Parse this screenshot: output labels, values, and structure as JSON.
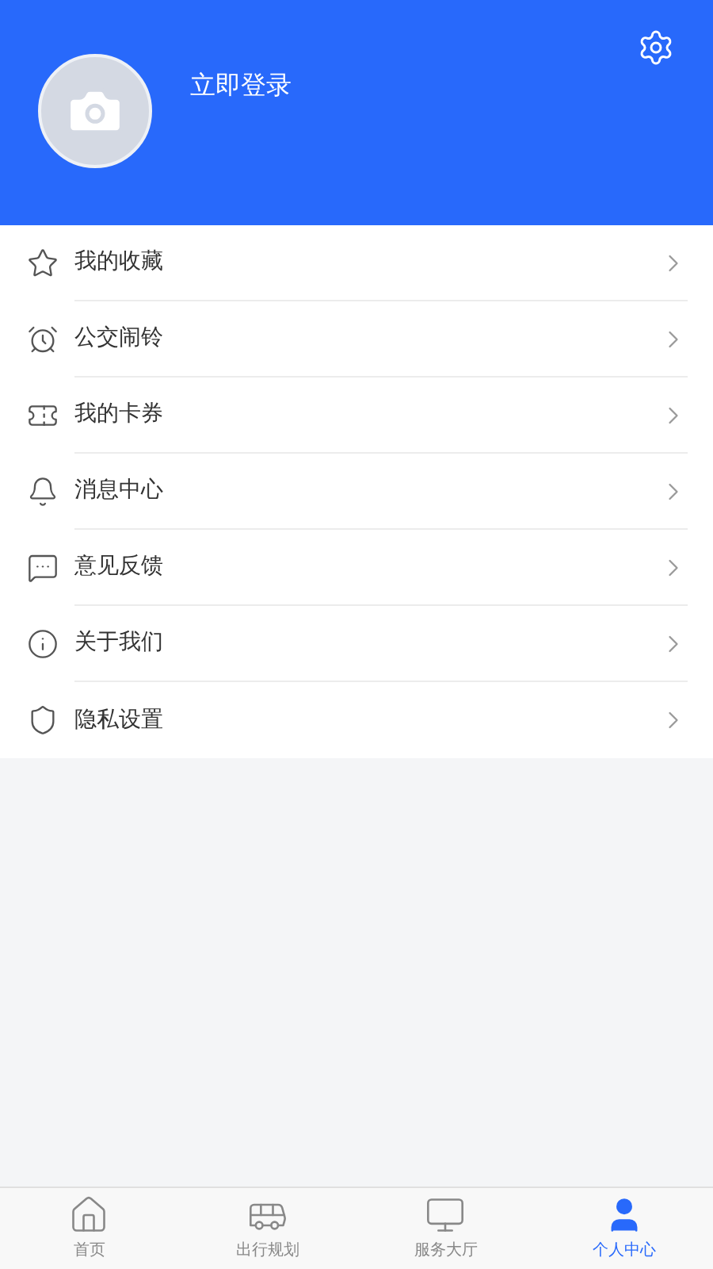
{
  "header": {
    "login": "立即登录"
  },
  "menu": [
    {
      "kind": "star",
      "label": "我的收藏"
    },
    {
      "kind": "alarm",
      "label": "公交闹铃"
    },
    {
      "kind": "ticket",
      "label": "我的卡券"
    },
    {
      "kind": "bell",
      "label": "消息中心"
    },
    {
      "kind": "feedback",
      "label": "意见反馈"
    },
    {
      "kind": "info",
      "label": "关于我们"
    },
    {
      "kind": "privacy",
      "label": "隐私设置"
    }
  ],
  "tabs": [
    {
      "kind": "home",
      "label": "首页",
      "selected": false
    },
    {
      "kind": "bus",
      "label": "出行规划",
      "selected": false
    },
    {
      "kind": "monitor",
      "label": "服务大厅",
      "selected": false
    },
    {
      "kind": "user",
      "label": "个人中心",
      "selected": true
    }
  ]
}
